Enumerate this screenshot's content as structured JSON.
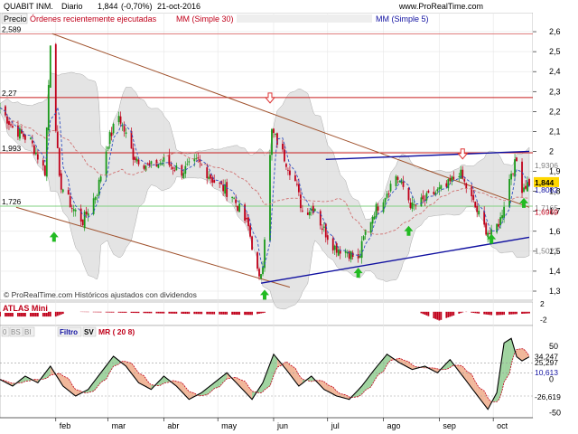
{
  "header": {
    "symbol": "QUABIT INM.",
    "period": "Diario",
    "last": "1,844",
    "change": "(-0,70%)",
    "date": "21-oct-2016",
    "site": "www.ProRealTime.com"
  },
  "legend_price": {
    "precio": "Precio",
    "ordenes": "Órdenes recientemente ejecutadas",
    "mm30": "MM (Simple 30)",
    "mm5": "MM (Simple 5)"
  },
  "watermark": "© ProRealTime.com Históricos ajustados con dividendos",
  "panel_atlas": {
    "title": "ATLAS Mini"
  },
  "panel_ind": {
    "buttons": [
      "0",
      "BS",
      "BI",
      "Filtro",
      "SV",
      "MR ( 20 8)"
    ]
  },
  "colors": {
    "up": "#1a9a1a",
    "down": "#c0001a",
    "mm30": "#d07070",
    "mm5": "#3050c0",
    "channel_brown": "#a0522d",
    "channel_blue": "#1010a0",
    "hline_red": "#c81e1e",
    "hline_pink": "#e08080",
    "hline_green": "#80d080",
    "band": "#d8d8d8",
    "arrow_up": "#22bb22",
    "arrow_down": "#dd3333"
  },
  "chart_data": [
    {
      "type": "candlestick",
      "title": "QUABIT INM.",
      "xlabel": "",
      "ylabel": "",
      "ylim": [
        1.3,
        2.65
      ],
      "x_ticks": [
        "feb",
        "mar",
        "abr",
        "may",
        "jun",
        "jul",
        "ago",
        "sep",
        "oct"
      ],
      "y_ticks": [
        "2,6",
        "2,5",
        "2,4",
        "2,3",
        "2,2",
        "2,1",
        "2",
        "1,9",
        "1,8",
        "1,7",
        "1,6",
        "1,5",
        "1,4",
        "1,3"
      ],
      "left_value_labels": [
        "2,589",
        "2,27",
        "1,993",
        "1,726"
      ],
      "right_value_labels": [
        {
          "text": "1,9306",
          "color": "#808080"
        },
        {
          "text": "1,844",
          "color": "#000000",
          "bg": "#ffd700"
        },
        {
          "text": "1,8082",
          "color": "#1010a0"
        },
        {
          "text": "1,7165",
          "color": "#808080"
        },
        {
          "text": "1,6969",
          "color": "#c0001a"
        },
        {
          "text": "1,5023",
          "color": "#808080"
        }
      ],
      "horizontal_lines": [
        {
          "value": 2.589,
          "kind": "pink"
        },
        {
          "value": 2.27,
          "kind": "red"
        },
        {
          "value": 1.993,
          "kind": "red"
        },
        {
          "value": 1.726,
          "kind": "green"
        }
      ],
      "series": [
        {
          "name": "MM (Simple 30)",
          "kind": "ma",
          "window": 30
        },
        {
          "name": "MM (Simple 5)",
          "kind": "ma",
          "window": 5
        }
      ],
      "channels": [
        {
          "kind": "brown",
          "from": [
            "jan-30",
            2.59
          ],
          "to": [
            "oct-21",
            1.72
          ]
        },
        {
          "kind": "brown",
          "from": [
            "jan-10",
            1.72
          ],
          "to": [
            "jun-10",
            1.32
          ]
        },
        {
          "kind": "blue",
          "from": [
            "may-25",
            1.34
          ],
          "to": [
            "oct-21",
            1.57
          ]
        },
        {
          "kind": "blue",
          "from": [
            "jun-30",
            1.96
          ],
          "to": [
            "oct-21",
            2.0
          ]
        }
      ],
      "arrows": [
        {
          "dir": "up",
          "date": "jan-31",
          "value": 1.57
        },
        {
          "dir": "up",
          "date": "may-27",
          "value": 1.28
        },
        {
          "dir": "down",
          "date": "may-30",
          "value": 2.27
        },
        {
          "dir": "up",
          "date": "jul-18",
          "value": 1.39
        },
        {
          "dir": "up",
          "date": "aug-15",
          "value": 1.6
        },
        {
          "dir": "down",
          "date": "sep-14",
          "value": 1.99
        },
        {
          "dir": "up",
          "date": "sep-30",
          "value": 1.56
        },
        {
          "dir": "up",
          "date": "oct-18",
          "value": 1.74
        }
      ],
      "key_prices": [
        {
          "date": "jan-01",
          "value": 2.22
        },
        {
          "date": "jan-08",
          "value": 2.12
        },
        {
          "date": "jan-18",
          "value": 2.05
        },
        {
          "date": "jan-26",
          "value": 1.9
        },
        {
          "date": "jan-29",
          "value": 2.55
        },
        {
          "date": "feb-03",
          "value": 1.85
        },
        {
          "date": "feb-10",
          "value": 1.72
        },
        {
          "date": "feb-16",
          "value": 1.65
        },
        {
          "date": "feb-24",
          "value": 1.8
        },
        {
          "date": "mar-01",
          "value": 2.05
        },
        {
          "date": "mar-07",
          "value": 2.18
        },
        {
          "date": "mar-15",
          "value": 1.98
        },
        {
          "date": "mar-24",
          "value": 1.92
        },
        {
          "date": "apr-01",
          "value": 1.95
        },
        {
          "date": "apr-11",
          "value": 1.9
        },
        {
          "date": "apr-20",
          "value": 1.95
        },
        {
          "date": "apr-29",
          "value": 1.85
        },
        {
          "date": "may-09",
          "value": 1.78
        },
        {
          "date": "may-18",
          "value": 1.62
        },
        {
          "date": "may-24",
          "value": 1.35
        },
        {
          "date": "may-26",
          "value": 1.45
        },
        {
          "date": "may-31",
          "value": 2.1
        },
        {
          "date": "jun-03",
          "value": 2.05
        },
        {
          "date": "jun-08",
          "value": 1.95
        },
        {
          "date": "jun-13",
          "value": 1.85
        },
        {
          "date": "jun-17",
          "value": 1.7
        },
        {
          "date": "jun-24",
          "value": 1.72
        },
        {
          "date": "jun-28",
          "value": 1.62
        },
        {
          "date": "jul-05",
          "value": 1.52
        },
        {
          "date": "jul-12",
          "value": 1.5
        },
        {
          "date": "jul-18",
          "value": 1.45
        },
        {
          "date": "jul-22",
          "value": 1.6
        },
        {
          "date": "jul-27",
          "value": 1.7
        },
        {
          "date": "aug-03",
          "value": 1.8
        },
        {
          "date": "aug-08",
          "value": 1.88
        },
        {
          "date": "aug-12",
          "value": 1.82
        },
        {
          "date": "aug-17",
          "value": 1.72
        },
        {
          "date": "aug-23",
          "value": 1.75
        },
        {
          "date": "aug-29",
          "value": 1.79
        },
        {
          "date": "sep-05",
          "value": 1.82
        },
        {
          "date": "sep-12",
          "value": 1.9
        },
        {
          "date": "sep-19",
          "value": 1.76
        },
        {
          "date": "sep-26",
          "value": 1.62
        },
        {
          "date": "sep-30",
          "value": 1.58
        },
        {
          "date": "oct-05",
          "value": 1.66
        },
        {
          "date": "oct-11",
          "value": 1.9
        },
        {
          "date": "oct-14",
          "value": 1.95
        },
        {
          "date": "oct-17",
          "value": 1.82
        },
        {
          "date": "oct-21",
          "value": 1.844
        }
      ]
    },
    {
      "type": "bar",
      "title": "ATLAS Mini",
      "xlabel": "",
      "ylabel": "",
      "ylim": [
        -3,
        2
      ],
      "y_ticks": [
        "2",
        "-2"
      ],
      "key_values": [
        {
          "date": "feb-01",
          "value": -1.2
        },
        {
          "date": "feb-08",
          "value": 0
        },
        {
          "date": "may-20",
          "value": -0.8
        },
        {
          "date": "may-30",
          "value": 0
        },
        {
          "date": "aug-20",
          "value": 0
        },
        {
          "date": "sep-01",
          "value": -2.2
        },
        {
          "date": "sep-15",
          "value": 0
        },
        {
          "date": "oct-01",
          "value": -0.9
        },
        {
          "date": "oct-21",
          "value": -0.4
        }
      ]
    },
    {
      "type": "line",
      "title": "MR ( 20 8)",
      "xlabel": "",
      "ylabel": "",
      "ylim": [
        -55,
        65
      ],
      "y_ticks": [
        "50",
        "0",
        "-50"
      ],
      "right_value_labels": [
        {
          "text": "34,247",
          "color": "#000000"
        },
        {
          "text": "25,297",
          "color": "#000000"
        },
        {
          "text": "10,613",
          "color": "#1010a0"
        },
        {
          "text": "-26,619",
          "color": "#000000"
        }
      ],
      "series": [
        {
          "name": "",
          "values_by_date": [
            {
              "date": "jan-01",
              "value": 0
            },
            {
              "date": "jan-08",
              "value": -10
            },
            {
              "date": "jan-15",
              "value": 5
            },
            {
              "date": "jan-22",
              "value": -5
            },
            {
              "date": "jan-29",
              "value": 20
            },
            {
              "date": "feb-05",
              "value": -10
            },
            {
              "date": "feb-12",
              "value": -25
            },
            {
              "date": "feb-19",
              "value": -15
            },
            {
              "date": "feb-26",
              "value": 10
            },
            {
              "date": "mar-04",
              "value": 35
            },
            {
              "date": "mar-11",
              "value": 20
            },
            {
              "date": "mar-18",
              "value": -5
            },
            {
              "date": "mar-25",
              "value": -15
            },
            {
              "date": "apr-01",
              "value": 5
            },
            {
              "date": "apr-08",
              "value": -10
            },
            {
              "date": "apr-15",
              "value": -30
            },
            {
              "date": "apr-22",
              "value": -20
            },
            {
              "date": "apr-29",
              "value": -5
            },
            {
              "date": "may-06",
              "value": 10
            },
            {
              "date": "may-13",
              "value": -10
            },
            {
              "date": "may-20",
              "value": -30
            },
            {
              "date": "may-26",
              "value": -5
            },
            {
              "date": "jun-01",
              "value": 38
            },
            {
              "date": "jun-08",
              "value": 15
            },
            {
              "date": "jun-15",
              "value": -10
            },
            {
              "date": "jun-22",
              "value": 5
            },
            {
              "date": "jun-29",
              "value": -15
            },
            {
              "date": "jul-06",
              "value": -25
            },
            {
              "date": "jul-13",
              "value": -30
            },
            {
              "date": "jul-20",
              "value": -10
            },
            {
              "date": "jul-27",
              "value": 15
            },
            {
              "date": "aug-03",
              "value": 38
            },
            {
              "date": "aug-10",
              "value": 25
            },
            {
              "date": "aug-17",
              "value": 15
            },
            {
              "date": "aug-24",
              "value": 20
            },
            {
              "date": "aug-31",
              "value": 10
            },
            {
              "date": "sep-07",
              "value": 30
            },
            {
              "date": "sep-14",
              "value": 5
            },
            {
              "date": "sep-21",
              "value": -20
            },
            {
              "date": "sep-28",
              "value": -45
            },
            {
              "date": "oct-03",
              "value": -20
            },
            {
              "date": "oct-07",
              "value": 55
            },
            {
              "date": "oct-11",
              "value": 62
            },
            {
              "date": "oct-15",
              "value": 25
            },
            {
              "date": "oct-21",
              "value": 34
            }
          ]
        }
      ]
    }
  ]
}
